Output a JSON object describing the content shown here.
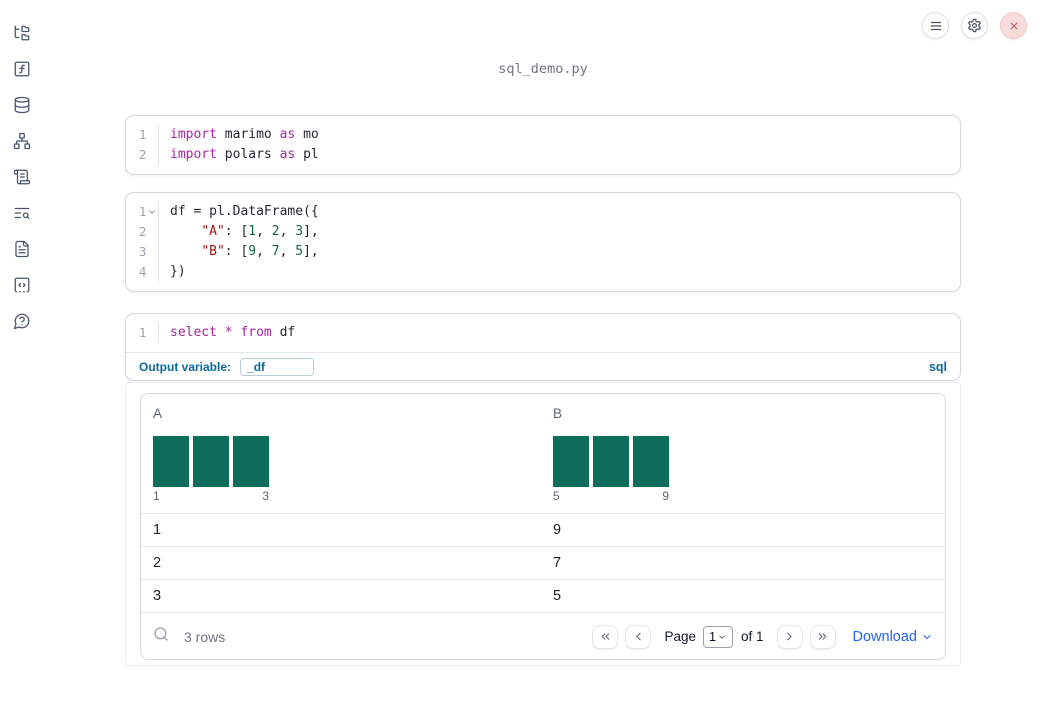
{
  "app": {
    "title": "sql_demo.py"
  },
  "colors": {
    "accent_blue": "#0d689c",
    "download_blue": "#2563eb",
    "histogram_teal": "#0d6e5c",
    "keyword": "#a626a4",
    "string": "#a31515",
    "number": "#116644",
    "close_red": "#c4595f"
  },
  "sidebar": {
    "items": [
      {
        "icon": "folder-tree-icon"
      },
      {
        "icon": "function-square-icon"
      },
      {
        "icon": "database-icon"
      },
      {
        "icon": "network-icon"
      },
      {
        "icon": "scroll-text-icon"
      },
      {
        "icon": "text-search-icon"
      },
      {
        "icon": "file-text-icon"
      },
      {
        "icon": "code-square-icon"
      },
      {
        "icon": "help-bubble-icon"
      }
    ]
  },
  "topbar": {
    "buttons": [
      "menu-icon",
      "settings-gear-icon",
      "close-icon"
    ]
  },
  "cells": [
    {
      "lines": [
        {
          "n": "1",
          "tokens": [
            {
              "t": "import",
              "c": "kw"
            },
            {
              "t": " marimo ",
              "c": ""
            },
            {
              "t": "as",
              "c": "kw"
            },
            {
              "t": " mo",
              "c": ""
            }
          ]
        },
        {
          "n": "2",
          "tokens": [
            {
              "t": "import",
              "c": "kw"
            },
            {
              "t": " polars ",
              "c": ""
            },
            {
              "t": "as",
              "c": "kw"
            },
            {
              "t": " pl",
              "c": ""
            }
          ]
        }
      ]
    },
    {
      "lines": [
        {
          "n": "1",
          "fold": true,
          "tokens": [
            {
              "t": "df = pl.DataFrame({",
              "c": ""
            }
          ]
        },
        {
          "n": "2",
          "tokens": [
            {
              "t": "    ",
              "c": ""
            },
            {
              "t": "\"A\"",
              "c": "str"
            },
            {
              "t": ": [",
              "c": ""
            },
            {
              "t": "1",
              "c": "num"
            },
            {
              "t": ", ",
              "c": ""
            },
            {
              "t": "2",
              "c": "num"
            },
            {
              "t": ", ",
              "c": ""
            },
            {
              "t": "3",
              "c": "num"
            },
            {
              "t": "],",
              "c": ""
            }
          ]
        },
        {
          "n": "3",
          "tokens": [
            {
              "t": "    ",
              "c": ""
            },
            {
              "t": "\"B\"",
              "c": "str"
            },
            {
              "t": ": [",
              "c": ""
            },
            {
              "t": "9",
              "c": "num"
            },
            {
              "t": ", ",
              "c": ""
            },
            {
              "t": "7",
              "c": "num"
            },
            {
              "t": ", ",
              "c": ""
            },
            {
              "t": "5",
              "c": "num"
            },
            {
              "t": "],",
              "c": ""
            }
          ]
        },
        {
          "n": "4",
          "tokens": [
            {
              "t": "})",
              "c": ""
            }
          ]
        }
      ]
    },
    {
      "lines": [
        {
          "n": "1",
          "tokens": [
            {
              "t": "select",
              "c": "kw"
            },
            {
              "t": " ",
              "c": ""
            },
            {
              "t": "*",
              "c": "kw"
            },
            {
              "t": " ",
              "c": ""
            },
            {
              "t": "from",
              "c": "kw"
            },
            {
              "t": " df",
              "c": ""
            }
          ]
        }
      ]
    }
  ],
  "sql_cell": {
    "output_variable_label": "Output variable:",
    "output_variable_value": "_df",
    "language_badge": "sql"
  },
  "table": {
    "columns": [
      {
        "label": "A",
        "histogram": {
          "bars": [
            1,
            1,
            1
          ],
          "min_label": "1",
          "max_label": "3"
        }
      },
      {
        "label": "B",
        "histogram": {
          "bars": [
            1,
            1,
            1
          ],
          "min_label": "5",
          "max_label": "9"
        }
      }
    ],
    "rows": [
      [
        "1",
        "9"
      ],
      [
        "2",
        "7"
      ],
      [
        "3",
        "5"
      ]
    ],
    "footer": {
      "row_count_label": "3 rows",
      "page_label": "Page",
      "page_value": "1",
      "of_label": "of 1",
      "download_label": "Download"
    }
  }
}
